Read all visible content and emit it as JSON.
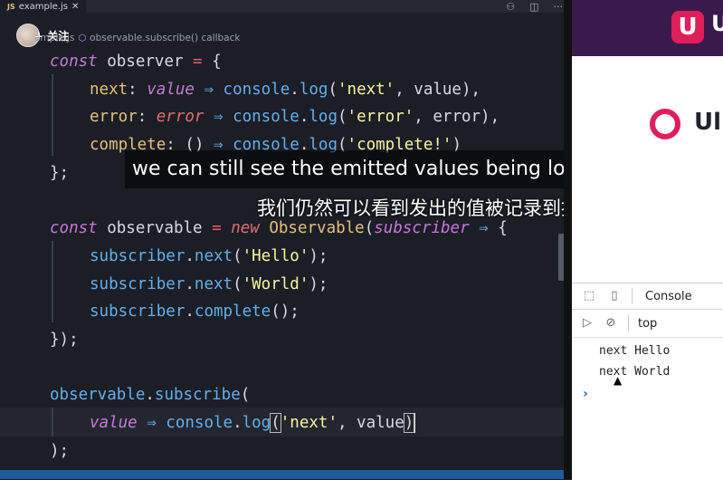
{
  "editor": {
    "tab_label": "example.js",
    "tab_lang": "JS",
    "tab_close": "✕",
    "actions": [
      "⚇",
      "◫",
      "···"
    ],
    "breadcrumb_prefix": "ample.js",
    "breadcrumb": "observable.subscribe() callback",
    "follow_label": "+ 关注"
  },
  "code": {
    "l1": {
      "kw": "const",
      "name": " observer ",
      "op": "=",
      "rest": " {"
    },
    "l2": {
      "prop": "next",
      "colon": ": ",
      "arg": "value",
      "arrow": " ⇒ ",
      "obj": "console",
      "dot": ".",
      "fn": "log",
      "open": "(",
      "str": "'next'",
      "rest": ", value),"
    },
    "l3": {
      "prop": "error",
      "colon": ": ",
      "arg": "error",
      "arrow": " ⇒ ",
      "obj": "console",
      "dot": ".",
      "fn": "log",
      "open": "(",
      "str": "'error'",
      "rest": ", error),"
    },
    "l4": {
      "prop": "complete",
      "colon": ": ",
      "params": "() ",
      "arrow": "⇒ ",
      "obj": "console",
      "dot": ".",
      "fn": "log",
      "open": "(",
      "str": "'complete!'",
      "rest": ")"
    },
    "l5": "};",
    "l6": {
      "kw": "const",
      "name": " observable ",
      "op": "=",
      "kw2": " new ",
      "cls": "Observable",
      "open": "(",
      "arg": "subscriber",
      "arrow": " ⇒ ",
      "rest": "{"
    },
    "l7": {
      "obj": "subscriber",
      "dot": ".",
      "fn": "next",
      "open": "(",
      "str": "'Hello'",
      "rest": ");"
    },
    "l8": {
      "obj": "subscriber",
      "dot": ".",
      "fn": "next",
      "open": "(",
      "str": "'World'",
      "rest": ");"
    },
    "l9": {
      "obj": "subscriber",
      "dot": ".",
      "fn": "complete",
      "rest": "();"
    },
    "l10": "});",
    "l11": {
      "obj": "observable",
      "dot": ".",
      "fn": "subscribe",
      "rest": "("
    },
    "l12": {
      "arg": "value",
      "arrow": " ⇒ ",
      "obj": "console",
      "dot": ".",
      "fn": "log",
      "open": "(",
      "str": "'next'",
      "rest": ", value",
      "close": ")"
    },
    "l13": ");"
  },
  "subtitles": {
    "en": "we can still see the emitted values being logged to the",
    "zh": "我们仍然可以看到发出的值被记录到控制台"
  },
  "browser": {
    "banner_logo": "U",
    "banner_text": "U",
    "brand_text": "Ul"
  },
  "devtools": {
    "tab_console": "Console",
    "context": "top",
    "logs": [
      "next Hello",
      "next World"
    ],
    "prompt": "›"
  }
}
